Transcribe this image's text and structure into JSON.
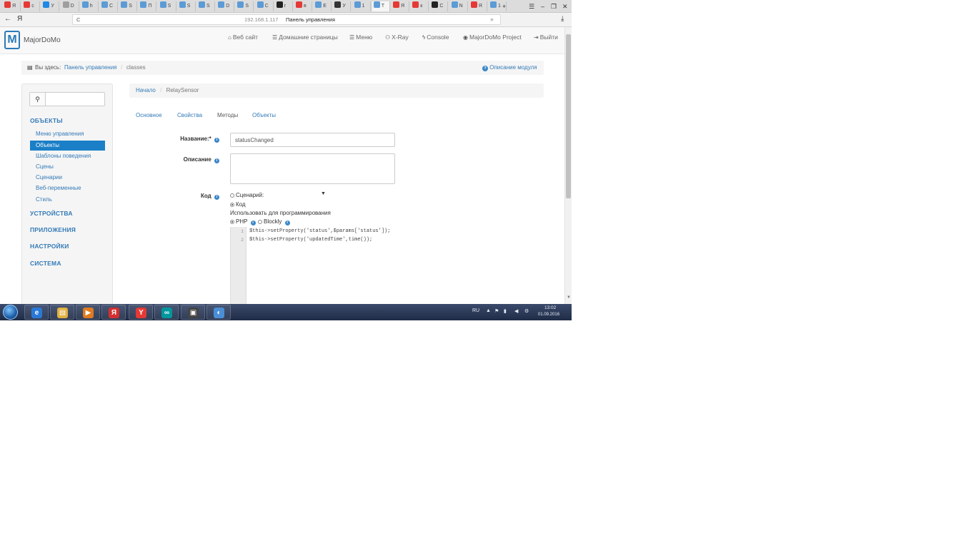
{
  "browser": {
    "tabs": [
      {
        "label": "Я",
        "color": "#e53935"
      },
      {
        "label": "с",
        "color": "#e53935"
      },
      {
        "label": "У",
        "color": "#1e88e5"
      },
      {
        "label": "D",
        "color": "#9e9e9e"
      },
      {
        "label": "h",
        "color": "#5c9bd6"
      },
      {
        "label": "C",
        "color": "#5c9bd6"
      },
      {
        "label": "S",
        "color": "#5c9bd6"
      },
      {
        "label": "П",
        "color": "#5c9bd6"
      },
      {
        "label": "S",
        "color": "#5c9bd6"
      },
      {
        "label": "S",
        "color": "#5c9bd6"
      },
      {
        "label": "S",
        "color": "#5c9bd6"
      },
      {
        "label": "D",
        "color": "#5c9bd6"
      },
      {
        "label": "S",
        "color": "#5c9bd6"
      },
      {
        "label": "C",
        "color": "#5c9bd6"
      },
      {
        "label": "r",
        "color": "#222222"
      },
      {
        "label": "в",
        "color": "#e53935"
      },
      {
        "label": "E",
        "color": "#5c9bd6"
      },
      {
        "label": "У",
        "color": "#333333"
      },
      {
        "label": "1",
        "color": "#5c9bd6"
      },
      {
        "label": "Т",
        "color": "#5c9bd6"
      },
      {
        "label": "Я",
        "color": "#e53935"
      },
      {
        "label": "к",
        "color": "#e53935"
      },
      {
        "label": "C",
        "color": "#222222"
      },
      {
        "label": "N",
        "color": "#5c9bd6"
      },
      {
        "label": "Я",
        "color": "#e53935"
      },
      {
        "label": "1",
        "color": "#5c9bd6"
      }
    ],
    "new_tab": "+",
    "window_controls": {
      "menu": "☰",
      "minimize": "–",
      "restore": "❐",
      "close": "✕"
    },
    "back": "←",
    "yandex": "Я",
    "reload": "C",
    "url_host": "192.168.1.117",
    "url_title": "Панель управления",
    "download_icon": "⤓"
  },
  "header": {
    "logo_letter": "M",
    "logo_text": "MajorDoMo",
    "nav": [
      {
        "icon": "⌂",
        "label": "Веб сайт"
      },
      {
        "icon": "☰",
        "label": "Домашние страницы"
      },
      {
        "icon": "☰",
        "label": "Меню"
      },
      {
        "icon": "⚇",
        "label": "X-Ray"
      },
      {
        "icon": "ϟ",
        "label": "Console"
      },
      {
        "icon": "◉",
        "label": "MajorDoMo Project"
      },
      {
        "icon": "⇥",
        "label": "Выйти"
      }
    ]
  },
  "breadcrumb": {
    "prefix": "Вы здесь:",
    "home": "Панель управления",
    "sep": "/",
    "current": "classes",
    "help": "Описание модуля"
  },
  "sidebar": {
    "sections": [
      {
        "title": "ОБЪЕКТЫ",
        "items": [
          "Меню управления",
          "Объекты",
          "Шаблоны поведения",
          "Сцены",
          "Сценарии",
          "Веб-переменные",
          "Стиль"
        ]
      },
      {
        "title": "УСТРОЙСТВА"
      },
      {
        "title": "ПРИЛОЖЕНИЯ"
      },
      {
        "title": "НАСТРОЙКИ"
      },
      {
        "title": "СИСТЕМА"
      }
    ],
    "active_item": "Объекты"
  },
  "content": {
    "breadcrumb": [
      "Начало",
      "RelaySensor"
    ],
    "tabs": [
      "Основное",
      "Свойства",
      "Методы",
      "Объекты"
    ],
    "active_tab": "Методы",
    "name_label": "Название:",
    "name_required": "*",
    "name_value": "statusChanged",
    "description_label": "Описание",
    "code_label": "Код",
    "radio_script": "Сценарий:",
    "radio_code": "Код",
    "use_label": "Использовать для программирования",
    "radio_php": "PHP",
    "radio_blockly": "Blockly",
    "code_lines": [
      {
        "num": "1",
        "text": "$this->setProperty('status',$params['status']);"
      },
      {
        "num": "2",
        "text": "$this->setProperty('updatedTime',time());"
      }
    ]
  },
  "taskbar": {
    "apps": [
      {
        "glyph": "e",
        "color": "#2a78d6"
      },
      {
        "glyph": "▤",
        "color": "#e0b040"
      },
      {
        "glyph": "▶",
        "color": "#e07b20"
      },
      {
        "glyph": "Я",
        "color": "#d32f2f"
      },
      {
        "glyph": "Y",
        "color": "#e53935"
      },
      {
        "glyph": "∞",
        "color": "#00979d"
      },
      {
        "glyph": "▣",
        "color": "#444444"
      },
      {
        "glyph": "◐",
        "color": "#4a8fd6"
      }
    ],
    "lang": "RU",
    "time": "13:02",
    "date": "01.09.2016"
  }
}
